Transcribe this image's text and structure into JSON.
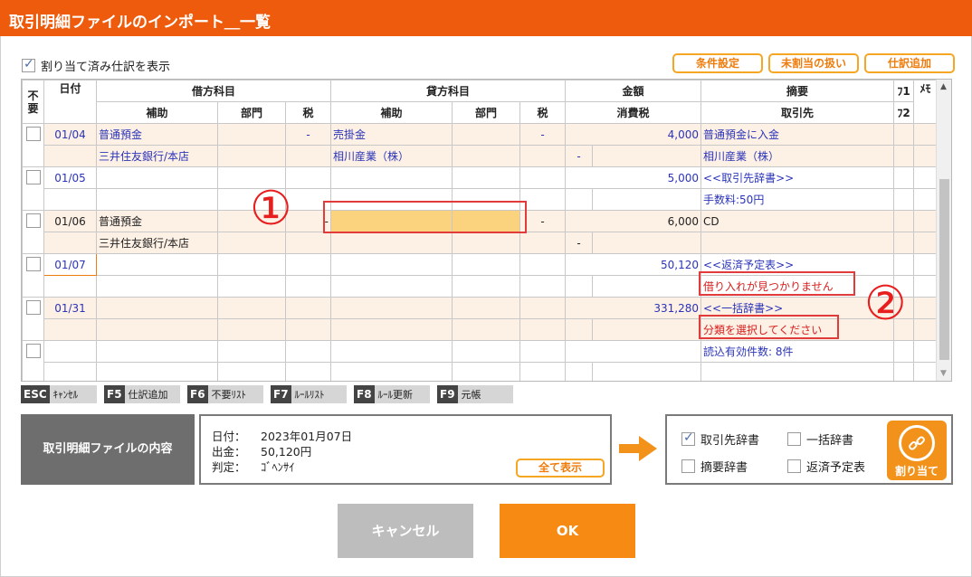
{
  "window": {
    "title": "取引明細ファイルのインポート＿一覧"
  },
  "toolbar": {
    "show_assigned_label": "割り当て済み仕訳を表示",
    "show_assigned_checked": true,
    "condition_btn": "条件設定",
    "unassigned_btn": "未割当の扱い",
    "add_journal_btn": "仕訳追加"
  },
  "grid": {
    "headers": {
      "unneeded": "不要",
      "date": "日付",
      "debit": "借方科目",
      "credit": "貸方科目",
      "amount": "金額",
      "summary": "摘要",
      "fu": "ﾌ1",
      "me": "ﾒﾓ",
      "sub": "補助",
      "dept": "部門",
      "tax": "税",
      "consumption_tax": "消費税",
      "partner": "取引先",
      "fu2": "ﾌ2"
    },
    "rows": [
      {
        "date": "01/04",
        "debit": "普通預金",
        "debit_tax": "-",
        "credit": "売掛金",
        "credit_tax": "-",
        "amount": "4,000",
        "summary": "普通預金に入金",
        "debit_sub": "三井住友銀行/本店",
        "credit_sub": "相川産業（株）",
        "sub_tax": "-",
        "partner": "相川産業（株）"
      },
      {
        "date": "01/05",
        "debit": "",
        "debit_tax": "",
        "credit": "",
        "credit_tax": "",
        "amount": "5,000",
        "summary": "<<取引先辞書>>",
        "debit_sub": "",
        "credit_sub": "",
        "sub_tax": "",
        "partner": "手数料:50円"
      },
      {
        "date": "01/06",
        "debit": "普通預金",
        "debit_tax": "-",
        "credit": "",
        "credit_tax": "-",
        "amount": "6,000",
        "summary": "CD",
        "debit_sub": "三井住友銀行/本店",
        "credit_sub": "",
        "sub_tax": "-",
        "partner": ""
      },
      {
        "date": "01/07",
        "debit": "",
        "debit_tax": "",
        "credit": "",
        "credit_tax": "",
        "amount": "50,120",
        "summary": "<<返済予定表>>",
        "debit_sub": "",
        "credit_sub": "",
        "sub_tax": "",
        "partner": "借り入れが見つかりません"
      },
      {
        "date": "01/31",
        "debit": "",
        "debit_tax": "",
        "credit": "",
        "credit_tax": "",
        "amount": "331,280",
        "summary": "<<一括辞書>>",
        "debit_sub": "",
        "credit_sub": "",
        "sub_tax": "",
        "partner": "分類を選択してください"
      }
    ],
    "footer_count": "読込有効件数: 8件"
  },
  "annotations": {
    "one": "①",
    "two": "②"
  },
  "fkeys": [
    {
      "key": "ESC",
      "label": "ｷｬﾝｾﾙ"
    },
    {
      "key": "F5",
      "label": "仕訳追加"
    },
    {
      "key": "F6",
      "label": "不要ﾘｽﾄ"
    },
    {
      "key": "F7",
      "label": "ﾙｰﾙﾘｽﾄ"
    },
    {
      "key": "F8",
      "label": "ﾙｰﾙ更新"
    },
    {
      "key": "F9",
      "label": "元帳"
    }
  ],
  "content": {
    "label": "取引明細ファイルの内容",
    "date_label": "日付：",
    "date_value": "2023年01月07日",
    "out_label": "出金：",
    "out_value": "50,120円",
    "judge_label": "判定：",
    "judge_value": "ｺﾞﾍﾝｻｲ",
    "show_all": "全て表示"
  },
  "dicts": {
    "partner_dict": "取引先辞書",
    "bulk_dict": "一括辞書",
    "summary_dict": "摘要辞書",
    "repay_schedule": "返済予定表",
    "assign": "割り当て"
  },
  "footer": {
    "cancel": "キャンセル",
    "ok": "OK"
  },
  "colors": {
    "accent": "#ee5b0c",
    "button_orange": "#f68a12",
    "link_blue": "#2b34b8",
    "warning_red": "#d81e1e",
    "row_peach": "#fdf0e4",
    "highlight": "#fbd27d"
  }
}
